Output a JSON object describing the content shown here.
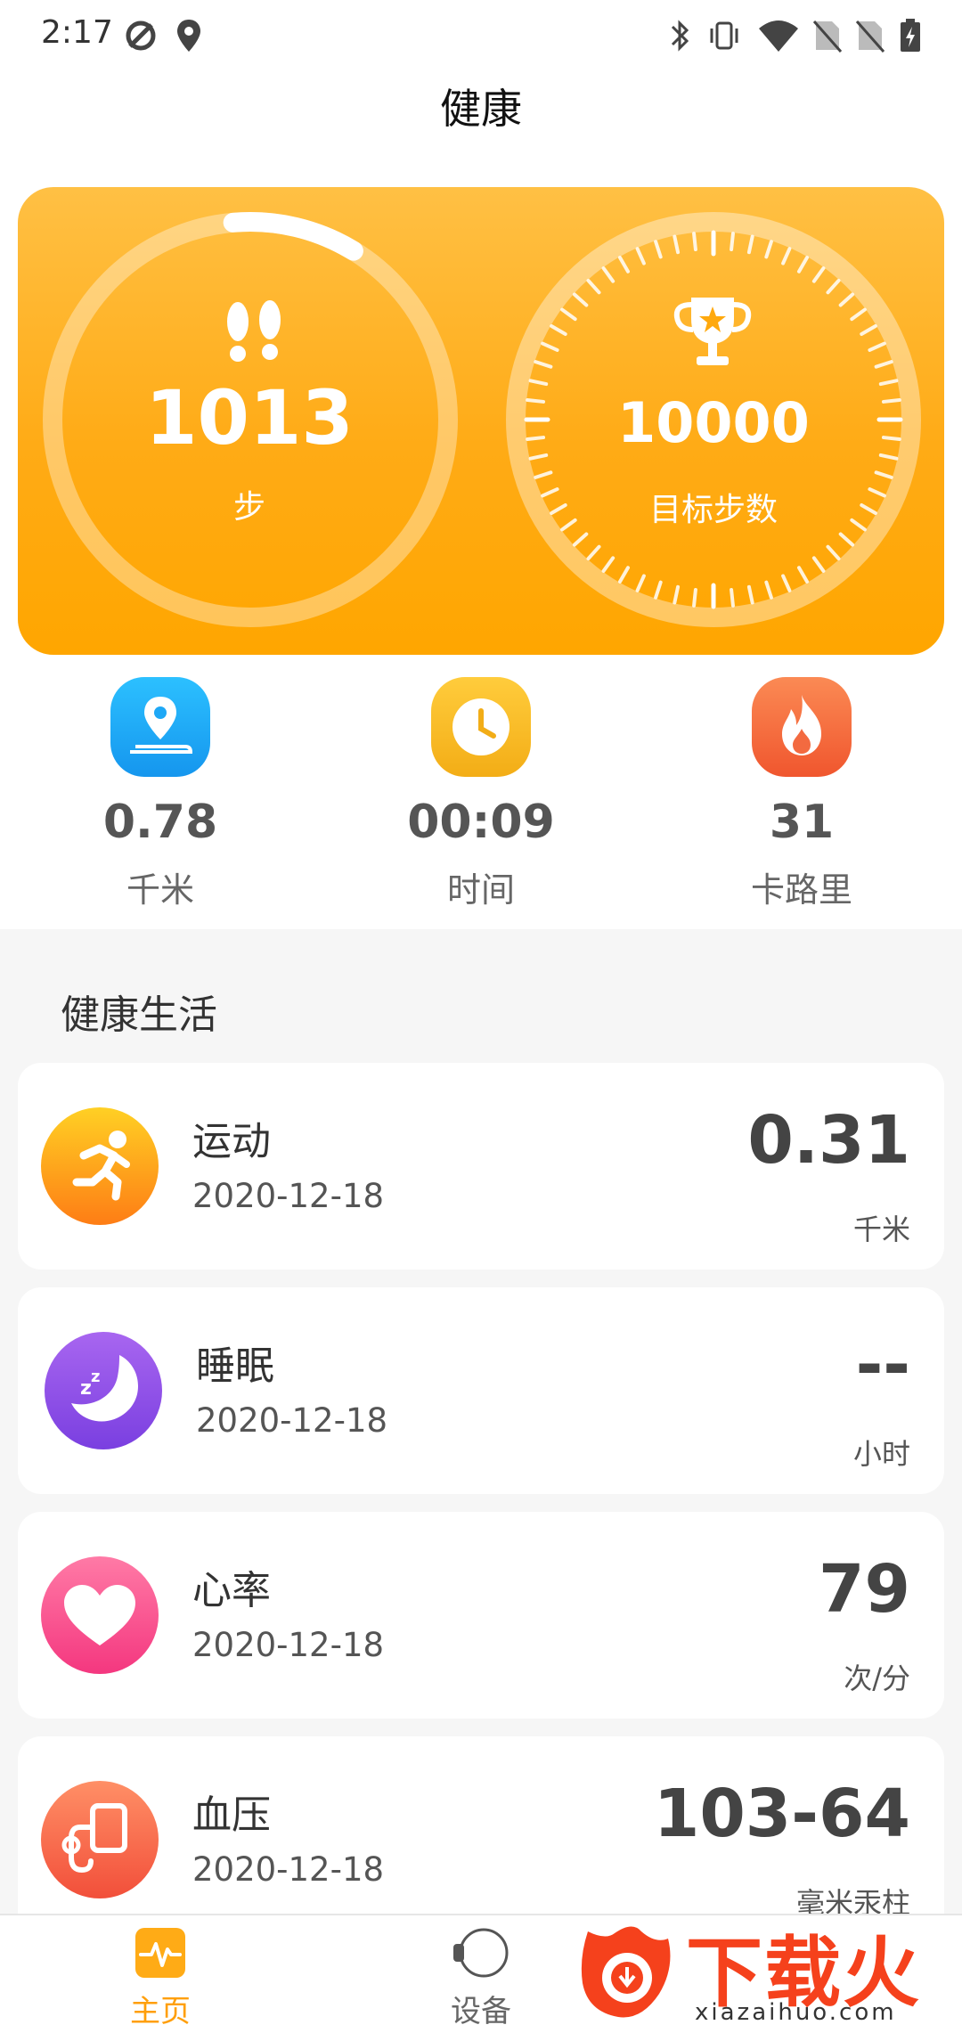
{
  "status_bar": {
    "time": "2:17"
  },
  "app_bar": {
    "title": "健康"
  },
  "hero": {
    "steps": {
      "value": "1013",
      "label": "步",
      "progress": 0.1013
    },
    "goal": {
      "value": "10000",
      "label": "目标步数"
    }
  },
  "stats": [
    {
      "value": "0.78",
      "label": "千米",
      "icon": "location-icon",
      "color": "#1aa5f5"
    },
    {
      "value": "00:09",
      "label": "时间",
      "icon": "clock-icon",
      "color": "#f5b41e"
    },
    {
      "value": "31",
      "label": "卡路里",
      "icon": "flame-icon",
      "color": "#f46a40"
    }
  ],
  "health_life": {
    "title": "健康生活",
    "items": [
      {
        "name": "运动",
        "date": "2020-12-18",
        "value": "0.31",
        "unit": "千米",
        "icon": "running-icon"
      },
      {
        "name": "睡眠",
        "date": "2020-12-18",
        "value": "--",
        "unit": "小时",
        "icon": "moon-icon"
      },
      {
        "name": "心率",
        "date": "2020-12-18",
        "value": "79",
        "unit": "次/分",
        "icon": "heart-icon"
      },
      {
        "name": "血压",
        "date": "2020-12-18",
        "value": "103-64",
        "unit": "毫米汞柱",
        "icon": "blood-pressure-icon"
      }
    ]
  },
  "bottom_nav": {
    "items": [
      {
        "label": "主页",
        "active": true
      },
      {
        "label": "设备",
        "active": false
      }
    ]
  },
  "watermark": {
    "text": "下载火",
    "sub": "xiazaihuo.com"
  }
}
